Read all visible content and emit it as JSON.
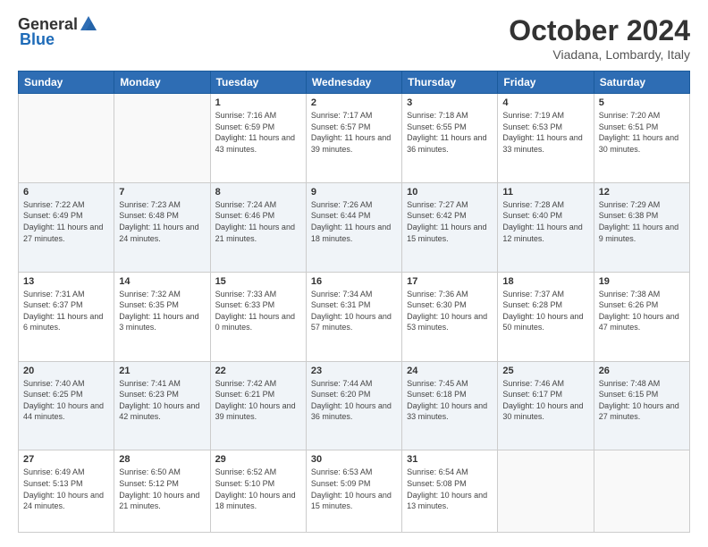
{
  "header": {
    "logo_general": "General",
    "logo_blue": "Blue",
    "month": "October 2024",
    "location": "Viadana, Lombardy, Italy"
  },
  "weekdays": [
    "Sunday",
    "Monday",
    "Tuesday",
    "Wednesday",
    "Thursday",
    "Friday",
    "Saturday"
  ],
  "weeks": [
    [
      {
        "day": "",
        "info": ""
      },
      {
        "day": "",
        "info": ""
      },
      {
        "day": "1",
        "info": "Sunrise: 7:16 AM\nSunset: 6:59 PM\nDaylight: 11 hours and 43 minutes."
      },
      {
        "day": "2",
        "info": "Sunrise: 7:17 AM\nSunset: 6:57 PM\nDaylight: 11 hours and 39 minutes."
      },
      {
        "day": "3",
        "info": "Sunrise: 7:18 AM\nSunset: 6:55 PM\nDaylight: 11 hours and 36 minutes."
      },
      {
        "day": "4",
        "info": "Sunrise: 7:19 AM\nSunset: 6:53 PM\nDaylight: 11 hours and 33 minutes."
      },
      {
        "day": "5",
        "info": "Sunrise: 7:20 AM\nSunset: 6:51 PM\nDaylight: 11 hours and 30 minutes."
      }
    ],
    [
      {
        "day": "6",
        "info": "Sunrise: 7:22 AM\nSunset: 6:49 PM\nDaylight: 11 hours and 27 minutes."
      },
      {
        "day": "7",
        "info": "Sunrise: 7:23 AM\nSunset: 6:48 PM\nDaylight: 11 hours and 24 minutes."
      },
      {
        "day": "8",
        "info": "Sunrise: 7:24 AM\nSunset: 6:46 PM\nDaylight: 11 hours and 21 minutes."
      },
      {
        "day": "9",
        "info": "Sunrise: 7:26 AM\nSunset: 6:44 PM\nDaylight: 11 hours and 18 minutes."
      },
      {
        "day": "10",
        "info": "Sunrise: 7:27 AM\nSunset: 6:42 PM\nDaylight: 11 hours and 15 minutes."
      },
      {
        "day": "11",
        "info": "Sunrise: 7:28 AM\nSunset: 6:40 PM\nDaylight: 11 hours and 12 minutes."
      },
      {
        "day": "12",
        "info": "Sunrise: 7:29 AM\nSunset: 6:38 PM\nDaylight: 11 hours and 9 minutes."
      }
    ],
    [
      {
        "day": "13",
        "info": "Sunrise: 7:31 AM\nSunset: 6:37 PM\nDaylight: 11 hours and 6 minutes."
      },
      {
        "day": "14",
        "info": "Sunrise: 7:32 AM\nSunset: 6:35 PM\nDaylight: 11 hours and 3 minutes."
      },
      {
        "day": "15",
        "info": "Sunrise: 7:33 AM\nSunset: 6:33 PM\nDaylight: 11 hours and 0 minutes."
      },
      {
        "day": "16",
        "info": "Sunrise: 7:34 AM\nSunset: 6:31 PM\nDaylight: 10 hours and 57 minutes."
      },
      {
        "day": "17",
        "info": "Sunrise: 7:36 AM\nSunset: 6:30 PM\nDaylight: 10 hours and 53 minutes."
      },
      {
        "day": "18",
        "info": "Sunrise: 7:37 AM\nSunset: 6:28 PM\nDaylight: 10 hours and 50 minutes."
      },
      {
        "day": "19",
        "info": "Sunrise: 7:38 AM\nSunset: 6:26 PM\nDaylight: 10 hours and 47 minutes."
      }
    ],
    [
      {
        "day": "20",
        "info": "Sunrise: 7:40 AM\nSunset: 6:25 PM\nDaylight: 10 hours and 44 minutes."
      },
      {
        "day": "21",
        "info": "Sunrise: 7:41 AM\nSunset: 6:23 PM\nDaylight: 10 hours and 42 minutes."
      },
      {
        "day": "22",
        "info": "Sunrise: 7:42 AM\nSunset: 6:21 PM\nDaylight: 10 hours and 39 minutes."
      },
      {
        "day": "23",
        "info": "Sunrise: 7:44 AM\nSunset: 6:20 PM\nDaylight: 10 hours and 36 minutes."
      },
      {
        "day": "24",
        "info": "Sunrise: 7:45 AM\nSunset: 6:18 PM\nDaylight: 10 hours and 33 minutes."
      },
      {
        "day": "25",
        "info": "Sunrise: 7:46 AM\nSunset: 6:17 PM\nDaylight: 10 hours and 30 minutes."
      },
      {
        "day": "26",
        "info": "Sunrise: 7:48 AM\nSunset: 6:15 PM\nDaylight: 10 hours and 27 minutes."
      }
    ],
    [
      {
        "day": "27",
        "info": "Sunrise: 6:49 AM\nSunset: 5:13 PM\nDaylight: 10 hours and 24 minutes."
      },
      {
        "day": "28",
        "info": "Sunrise: 6:50 AM\nSunset: 5:12 PM\nDaylight: 10 hours and 21 minutes."
      },
      {
        "day": "29",
        "info": "Sunrise: 6:52 AM\nSunset: 5:10 PM\nDaylight: 10 hours and 18 minutes."
      },
      {
        "day": "30",
        "info": "Sunrise: 6:53 AM\nSunset: 5:09 PM\nDaylight: 10 hours and 15 minutes."
      },
      {
        "day": "31",
        "info": "Sunrise: 6:54 AM\nSunset: 5:08 PM\nDaylight: 10 hours and 13 minutes."
      },
      {
        "day": "",
        "info": ""
      },
      {
        "day": "",
        "info": ""
      }
    ]
  ]
}
